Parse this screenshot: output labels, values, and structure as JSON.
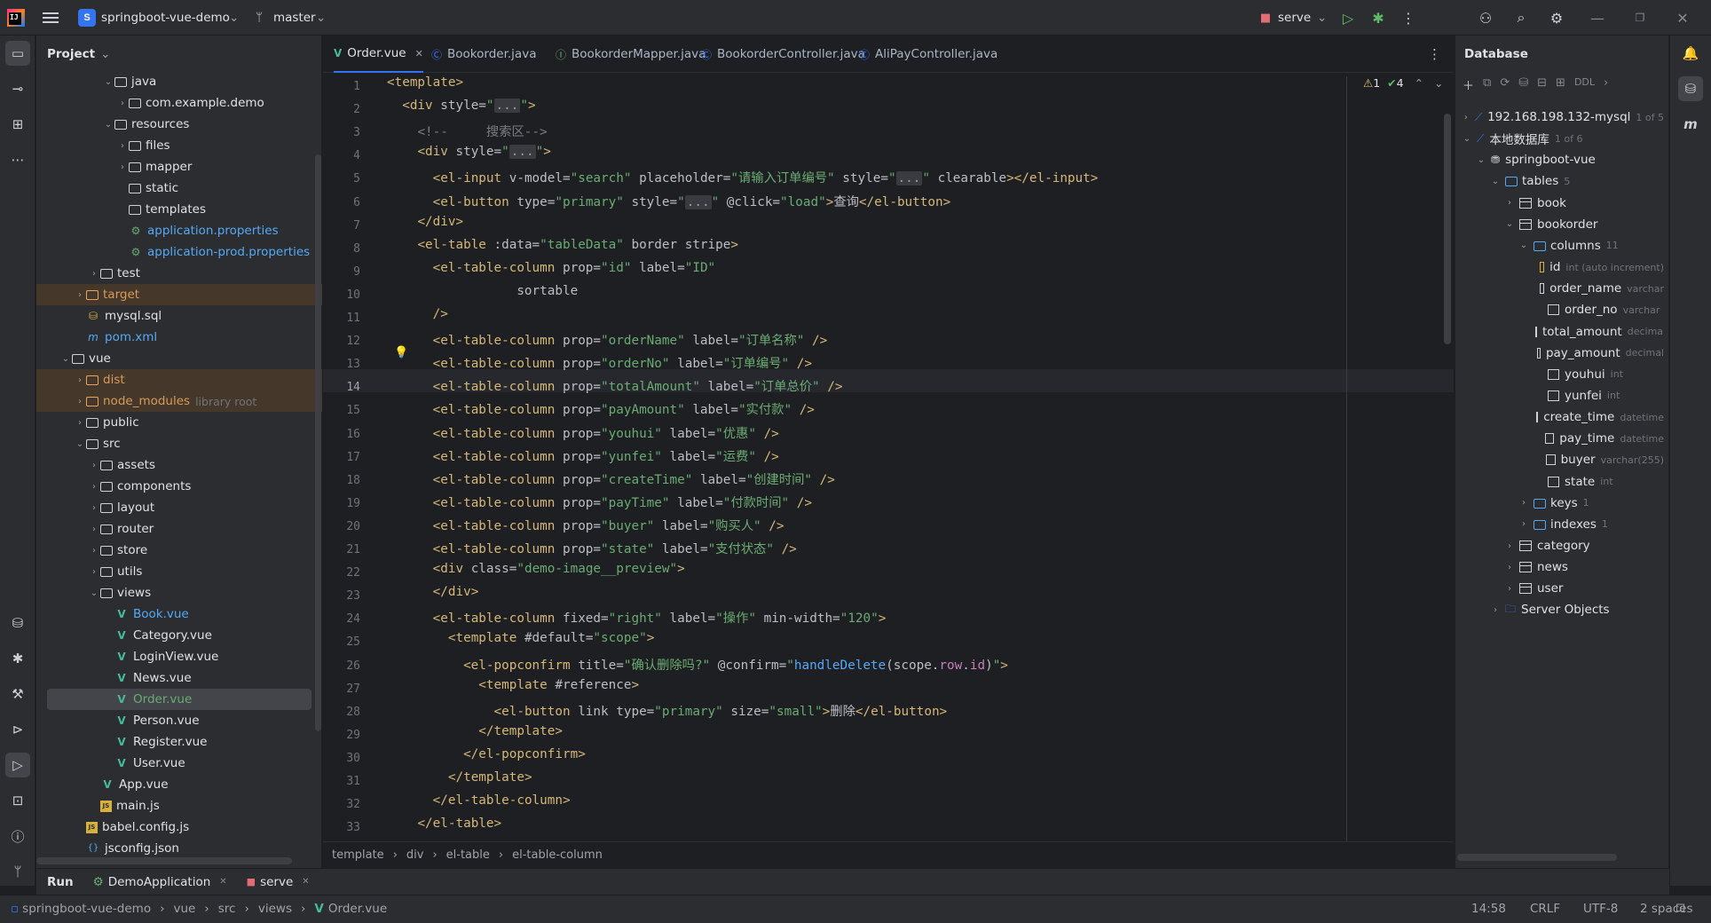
{
  "titlebar": {
    "project_badge": "S",
    "project_name": "springboot-vue-demo",
    "branch": "master",
    "run_config": "serve"
  },
  "project_panel": {
    "title": "Project",
    "tree": [
      {
        "label": "java",
        "depth": 4,
        "type": "folder",
        "expanded": true
      },
      {
        "label": "com.example.demo",
        "depth": 5,
        "type": "package",
        "expanded": false
      },
      {
        "label": "resources",
        "depth": 4,
        "type": "folder",
        "expanded": true
      },
      {
        "label": "files",
        "depth": 5,
        "type": "folder",
        "expanded": false
      },
      {
        "label": "mapper",
        "depth": 5,
        "type": "folder",
        "expanded": false
      },
      {
        "label": "static",
        "depth": 5,
        "type": "folder"
      },
      {
        "label": "templates",
        "depth": 5,
        "type": "folder"
      },
      {
        "label": "application.properties",
        "depth": 5,
        "type": "props"
      },
      {
        "label": "application-prod.properties",
        "depth": 5,
        "type": "props"
      },
      {
        "label": "test",
        "depth": 3,
        "type": "folder",
        "expanded": false
      },
      {
        "label": "target",
        "depth": 2,
        "type": "folder-orange",
        "expanded": false,
        "highlight": true
      },
      {
        "label": "mysql.sql",
        "depth": 2,
        "type": "sql"
      },
      {
        "label": "pom.xml",
        "depth": 2,
        "type": "maven"
      },
      {
        "label": "vue",
        "depth": 1,
        "type": "folder",
        "expanded": true
      },
      {
        "label": "dist",
        "depth": 2,
        "type": "folder-orange",
        "expanded": false,
        "highlight": true
      },
      {
        "label": "node_modules",
        "suffix": "library root",
        "depth": 2,
        "type": "folder-orange",
        "expanded": false,
        "highlight": true
      },
      {
        "label": "public",
        "depth": 2,
        "type": "folder",
        "expanded": false
      },
      {
        "label": "src",
        "depth": 2,
        "type": "folder",
        "expanded": true
      },
      {
        "label": "assets",
        "depth": 3,
        "type": "folder",
        "expanded": false
      },
      {
        "label": "components",
        "depth": 3,
        "type": "folder",
        "expanded": false
      },
      {
        "label": "layout",
        "depth": 3,
        "type": "folder",
        "expanded": false
      },
      {
        "label": "router",
        "depth": 3,
        "type": "folder",
        "expanded": false
      },
      {
        "label": "store",
        "depth": 3,
        "type": "folder",
        "expanded": false
      },
      {
        "label": "utils",
        "depth": 3,
        "type": "folder",
        "expanded": false
      },
      {
        "label": "views",
        "depth": 3,
        "type": "folder",
        "expanded": true
      },
      {
        "label": "Book.vue",
        "depth": 4,
        "type": "vue",
        "color": "#56a8f5"
      },
      {
        "label": "Category.vue",
        "depth": 4,
        "type": "vue"
      },
      {
        "label": "LoginView.vue",
        "depth": 4,
        "type": "vue"
      },
      {
        "label": "News.vue",
        "depth": 4,
        "type": "vue"
      },
      {
        "label": "Order.vue",
        "depth": 4,
        "type": "vue",
        "color": "#6aab73",
        "selected": true
      },
      {
        "label": "Person.vue",
        "depth": 4,
        "type": "vue"
      },
      {
        "label": "Register.vue",
        "depth": 4,
        "type": "vue"
      },
      {
        "label": "User.vue",
        "depth": 4,
        "type": "vue"
      },
      {
        "label": "App.vue",
        "depth": 3,
        "type": "vue"
      },
      {
        "label": "main.js",
        "depth": 3,
        "type": "js"
      },
      {
        "label": "babel.config.js",
        "depth": 2,
        "type": "js"
      },
      {
        "label": "jsconfig.json",
        "depth": 2,
        "type": "json"
      }
    ]
  },
  "editor": {
    "tabs": [
      {
        "label": "Order.vue",
        "kind": "vue",
        "active": true
      },
      {
        "label": "Bookorder.java",
        "kind": "class"
      },
      {
        "label": "BookorderMapper.java",
        "kind": "iface"
      },
      {
        "label": "BookorderController.java",
        "kind": "class"
      },
      {
        "label": "AliPayController.java",
        "kind": "class"
      }
    ],
    "current_line": 14,
    "inspections": {
      "warnings": "1",
      "ok": "4"
    },
    "lines": [
      [
        [
          "t",
          "<template>"
        ]
      ],
      [
        [
          "a",
          "  "
        ],
        [
          "t",
          "<div "
        ],
        [
          "a",
          "style="
        ],
        [
          "s",
          "\""
        ],
        [
          "f",
          "..."
        ],
        [
          "s",
          "\""
        ],
        [
          "t",
          ">"
        ]
      ],
      [
        [
          "a",
          "    "
        ],
        [
          "cm",
          "<!--     搜索区-->"
        ]
      ],
      [
        [
          "a",
          "    "
        ],
        [
          "t",
          "<div "
        ],
        [
          "a",
          "style="
        ],
        [
          "s",
          "\""
        ],
        [
          "f",
          "..."
        ],
        [
          "s",
          "\""
        ],
        [
          "t",
          ">"
        ]
      ],
      [
        [
          "a",
          "      "
        ],
        [
          "t",
          "<el-input "
        ],
        [
          "a",
          "v-model="
        ],
        [
          "s",
          "\"search\" "
        ],
        [
          "a",
          "placeholder="
        ],
        [
          "s",
          "\"请输入订单编号\" "
        ],
        [
          "a",
          "style="
        ],
        [
          "s",
          "\""
        ],
        [
          "f",
          "..."
        ],
        [
          "s",
          "\" "
        ],
        [
          "a",
          "clearable"
        ],
        [
          "t",
          "></el-input>"
        ]
      ],
      [
        [
          "a",
          "      "
        ],
        [
          "t",
          "<el-button "
        ],
        [
          "a",
          "type="
        ],
        [
          "s",
          "\"primary\" "
        ],
        [
          "a",
          "style="
        ],
        [
          "s",
          "\""
        ],
        [
          "f",
          "..."
        ],
        [
          "s",
          "\" "
        ],
        [
          "a",
          "@click="
        ],
        [
          "s",
          "\"load\""
        ],
        [
          "t",
          ">"
        ],
        [
          "a",
          "查询"
        ],
        [
          "t",
          "</el-button>"
        ]
      ],
      [
        [
          "a",
          "    "
        ],
        [
          "t",
          "</div>"
        ]
      ],
      [
        [
          "a",
          "    "
        ],
        [
          "t",
          "<el-table "
        ],
        [
          "a",
          ":data="
        ],
        [
          "s",
          "\"tableData\" "
        ],
        [
          "a",
          "border stripe"
        ],
        [
          "t",
          ">"
        ]
      ],
      [
        [
          "a",
          "      "
        ],
        [
          "t",
          "<el-table-column "
        ],
        [
          "a",
          "prop="
        ],
        [
          "s",
          "\"id\" "
        ],
        [
          "a",
          "label="
        ],
        [
          "s",
          "\"ID\""
        ]
      ],
      [
        [
          "a",
          "                 sortable"
        ]
      ],
      [
        [
          "a",
          "      "
        ],
        [
          "t",
          "/>"
        ]
      ],
      [
        [
          "a",
          "      "
        ],
        [
          "t",
          "<el-table-column "
        ],
        [
          "a",
          "prop="
        ],
        [
          "s",
          "\"orderName\" "
        ],
        [
          "a",
          "label="
        ],
        [
          "s",
          "\"订单名称\" "
        ],
        [
          "t",
          "/>"
        ]
      ],
      [
        [
          "a",
          "      "
        ],
        [
          "t",
          "<el-table-column "
        ],
        [
          "a",
          "prop="
        ],
        [
          "s",
          "\"orderNo\" "
        ],
        [
          "a",
          "label="
        ],
        [
          "s",
          "\"订单编号\" "
        ],
        [
          "t",
          "/>"
        ]
      ],
      [
        [
          "a",
          "      "
        ],
        [
          "t",
          "<el-table-column "
        ],
        [
          "a",
          "prop="
        ],
        [
          "s",
          "\"totalAmount\" "
        ],
        [
          "a",
          "label="
        ],
        [
          "s",
          "\"订单总价\" "
        ],
        [
          "t",
          "/>"
        ]
      ],
      [
        [
          "a",
          "      "
        ],
        [
          "t",
          "<el-table-column "
        ],
        [
          "a",
          "prop="
        ],
        [
          "s",
          "\"payAmount\" "
        ],
        [
          "a",
          "label="
        ],
        [
          "s",
          "\"实付款\" "
        ],
        [
          "t",
          "/>"
        ]
      ],
      [
        [
          "a",
          "      "
        ],
        [
          "t",
          "<el-table-column "
        ],
        [
          "a",
          "prop="
        ],
        [
          "s",
          "\"youhui\" "
        ],
        [
          "a",
          "label="
        ],
        [
          "s",
          "\"优惠\" "
        ],
        [
          "t",
          "/>"
        ]
      ],
      [
        [
          "a",
          "      "
        ],
        [
          "t",
          "<el-table-column "
        ],
        [
          "a",
          "prop="
        ],
        [
          "s",
          "\"yunfei\" "
        ],
        [
          "a",
          "label="
        ],
        [
          "s",
          "\"运费\" "
        ],
        [
          "t",
          "/>"
        ]
      ],
      [
        [
          "a",
          "      "
        ],
        [
          "t",
          "<el-table-column "
        ],
        [
          "a",
          "prop="
        ],
        [
          "s",
          "\"createTime\" "
        ],
        [
          "a",
          "label="
        ],
        [
          "s",
          "\"创建时间\" "
        ],
        [
          "t",
          "/>"
        ]
      ],
      [
        [
          "a",
          "      "
        ],
        [
          "t",
          "<el-table-column "
        ],
        [
          "a",
          "prop="
        ],
        [
          "s",
          "\"payTime\" "
        ],
        [
          "a",
          "label="
        ],
        [
          "s",
          "\"付款时间\" "
        ],
        [
          "t",
          "/>"
        ]
      ],
      [
        [
          "a",
          "      "
        ],
        [
          "t",
          "<el-table-column "
        ],
        [
          "a",
          "prop="
        ],
        [
          "s",
          "\"buyer\" "
        ],
        [
          "a",
          "label="
        ],
        [
          "s",
          "\"购买人\" "
        ],
        [
          "t",
          "/>"
        ]
      ],
      [
        [
          "a",
          "      "
        ],
        [
          "t",
          "<el-table-column "
        ],
        [
          "a",
          "prop="
        ],
        [
          "s",
          "\"state\" "
        ],
        [
          "a",
          "label="
        ],
        [
          "s",
          "\"支付状态\" "
        ],
        [
          "t",
          "/>"
        ]
      ],
      [
        [
          "a",
          "      "
        ],
        [
          "t",
          "<div "
        ],
        [
          "a",
          "class="
        ],
        [
          "s",
          "\"demo-image__preview\""
        ],
        [
          "t",
          ">"
        ]
      ],
      [
        [
          "a",
          "      "
        ],
        [
          "t",
          "</div>"
        ]
      ],
      [
        [
          "a",
          "      "
        ],
        [
          "t",
          "<el-table-column "
        ],
        [
          "a",
          "fixed="
        ],
        [
          "s",
          "\"right\" "
        ],
        [
          "a",
          "label="
        ],
        [
          "s",
          "\"操作\" "
        ],
        [
          "a",
          "min-width="
        ],
        [
          "s",
          "\"120\""
        ],
        [
          "t",
          ">"
        ]
      ],
      [
        [
          "a",
          "        "
        ],
        [
          "t",
          "<template "
        ],
        [
          "a",
          "#default="
        ],
        [
          "s",
          "\"scope\""
        ],
        [
          "t",
          ">"
        ]
      ],
      [
        [
          "a",
          "          "
        ],
        [
          "t",
          "<el-popconfirm "
        ],
        [
          "a",
          "title="
        ],
        [
          "s",
          "\"确认删除吗?\" "
        ],
        [
          "a",
          "@confirm="
        ],
        [
          "s",
          "\""
        ],
        [
          "k",
          "handleDelete"
        ],
        [
          "a",
          "(scope."
        ],
        [
          "pl",
          "row"
        ],
        [
          "a",
          "."
        ],
        [
          "pl",
          "id"
        ],
        [
          "a",
          ")"
        ],
        [
          "s",
          "\""
        ],
        [
          "t",
          ">"
        ]
      ],
      [
        [
          "a",
          "            "
        ],
        [
          "t",
          "<template "
        ],
        [
          "a",
          "#reference"
        ],
        [
          "t",
          ">"
        ]
      ],
      [
        [
          "a",
          "              "
        ],
        [
          "t",
          "<el-button "
        ],
        [
          "a",
          "link type="
        ],
        [
          "s",
          "\"primary\" "
        ],
        [
          "a",
          "size="
        ],
        [
          "s",
          "\"small\""
        ],
        [
          "t",
          ">"
        ],
        [
          "a",
          "删除"
        ],
        [
          "t",
          "</el-button>"
        ]
      ],
      [
        [
          "a",
          "            "
        ],
        [
          "t",
          "</template>"
        ]
      ],
      [
        [
          "a",
          "          "
        ],
        [
          "t",
          "</el-popconfirm>"
        ]
      ],
      [
        [
          "a",
          "        "
        ],
        [
          "t",
          "</template>"
        ]
      ],
      [
        [
          "a",
          "      "
        ],
        [
          "t",
          "</el-table-column>"
        ]
      ],
      [
        [
          "a",
          "    "
        ],
        [
          "t",
          "</el-table>"
        ]
      ]
    ],
    "breadcrumbs": [
      "template",
      "div",
      "el-table",
      "el-table-column"
    ]
  },
  "database_panel": {
    "title": "Database",
    "toolbar_ddl": "DDL",
    "tree": [
      {
        "label": "192.168.198.132-mysql",
        "suffix": "1 of 5",
        "depth": 0,
        "kind": "server",
        "arrow": ">"
      },
      {
        "label": "本地数据库",
        "suffix": "1 of 6",
        "depth": 0,
        "kind": "server",
        "arrow": "v"
      },
      {
        "label": "springboot-vue",
        "depth": 1,
        "kind": "schema",
        "arrow": "v"
      },
      {
        "label": "tables",
        "suffix": "5",
        "depth": 2,
        "kind": "folder",
        "arrow": "v"
      },
      {
        "label": "book",
        "depth": 3,
        "kind": "table",
        "arrow": ">"
      },
      {
        "label": "bookorder",
        "depth": 3,
        "kind": "table",
        "arrow": "v"
      },
      {
        "label": "columns",
        "suffix": "11",
        "depth": 4,
        "kind": "folder",
        "arrow": "v"
      },
      {
        "label": "id",
        "suffix": "int (auto increment)",
        "depth": 5,
        "kind": "key"
      },
      {
        "label": "order_name",
        "suffix": "varchar",
        "depth": 5,
        "kind": "col"
      },
      {
        "label": "order_no",
        "suffix": "varchar",
        "depth": 5,
        "kind": "col"
      },
      {
        "label": "total_amount",
        "suffix": "decimal",
        "depth": 5,
        "kind": "col"
      },
      {
        "label": "pay_amount",
        "suffix": "decimal",
        "depth": 5,
        "kind": "col"
      },
      {
        "label": "youhui",
        "suffix": "int",
        "depth": 5,
        "kind": "col"
      },
      {
        "label": "yunfei",
        "suffix": "int",
        "depth": 5,
        "kind": "col"
      },
      {
        "label": "create_time",
        "suffix": "datetime",
        "depth": 5,
        "kind": "col"
      },
      {
        "label": "pay_time",
        "suffix": "datetime",
        "depth": 5,
        "kind": "col"
      },
      {
        "label": "buyer",
        "suffix": "varchar(255)",
        "depth": 5,
        "kind": "col"
      },
      {
        "label": "state",
        "suffix": "int",
        "depth": 5,
        "kind": "col"
      },
      {
        "label": "keys",
        "suffix": "1",
        "depth": 4,
        "kind": "folder",
        "arrow": ">"
      },
      {
        "label": "indexes",
        "suffix": "1",
        "depth": 4,
        "kind": "folder",
        "arrow": ">"
      },
      {
        "label": "category",
        "depth": 3,
        "kind": "table",
        "arrow": ">"
      },
      {
        "label": "news",
        "depth": 3,
        "kind": "table",
        "arrow": ">"
      },
      {
        "label": "user",
        "depth": 3,
        "kind": "table",
        "arrow": ">"
      },
      {
        "label": "Server Objects",
        "depth": 2,
        "kind": "serverobj",
        "arrow": ">"
      }
    ]
  },
  "bottom_bar": {
    "tabs": [
      {
        "label": "Run",
        "bold": true
      },
      {
        "label": "DemoApplication",
        "closable": true
      },
      {
        "label": "serve",
        "closable": true
      }
    ]
  },
  "statusbar": {
    "path": [
      "springboot-vue-demo",
      "vue",
      "src",
      "views",
      "Order.vue"
    ],
    "position": "14:58",
    "line_sep": "CRLF",
    "encoding": "UTF-8",
    "indent": "2 spaces"
  }
}
